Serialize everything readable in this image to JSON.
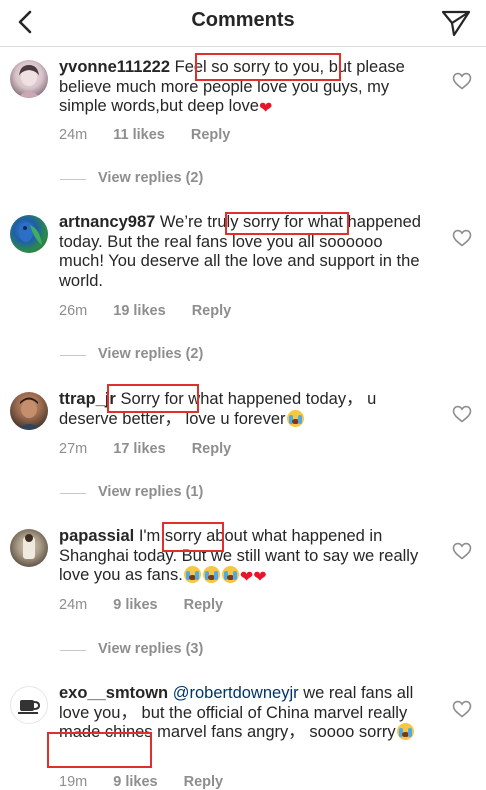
{
  "header": {
    "title": "Comments"
  },
  "comments": [
    {
      "username": "yvonne111222",
      "text_a": "Feel so sorry to you,",
      "text_b": "but please believe much more people love you guys, my simple words,but deep love",
      "time": "24m",
      "likes": "11 likes",
      "reply": "Reply",
      "view_replies": "View replies (2)"
    },
    {
      "username": "artnancy987",
      "text_a": "We’re truly sorry for what happened today. But the real fans love you all soooooo much! You deserve all the love and support in the world.",
      "time": "26m",
      "likes": "19 likes",
      "reply": "Reply",
      "view_replies": "View replies (2)"
    },
    {
      "username": "ttrap_jr",
      "text_a": "Sorry for what happened today， u deserve better， love u forever",
      "time": "27m",
      "likes": "17 likes",
      "reply": "Reply",
      "view_replies": "View replies (1)"
    },
    {
      "username": "papassial",
      "text_a": "I'm sorry about what happened in Shanghai today. But we still want to say we really love you as fans.",
      "time": "24m",
      "likes": "9 likes",
      "reply": "Reply",
      "view_replies": "View replies (3)"
    },
    {
      "username": "exo__smtown",
      "mention": "@robertdowneyjr",
      "text_a": "we real fans all love you， but the official of China marvel really made chines marvel fans angry， soooo sorry",
      "time": "19m",
      "likes": "9 likes",
      "reply": "Reply"
    }
  ],
  "colors": {
    "highlight_box": "#e0302b",
    "meta_text": "#8e8e8e",
    "mention": "#003569"
  },
  "icons": [
    "back-chevron-icon",
    "send-direct-icon",
    "heart-outline-icon",
    "red-heart-emoji",
    "crying-face-emoji"
  ]
}
